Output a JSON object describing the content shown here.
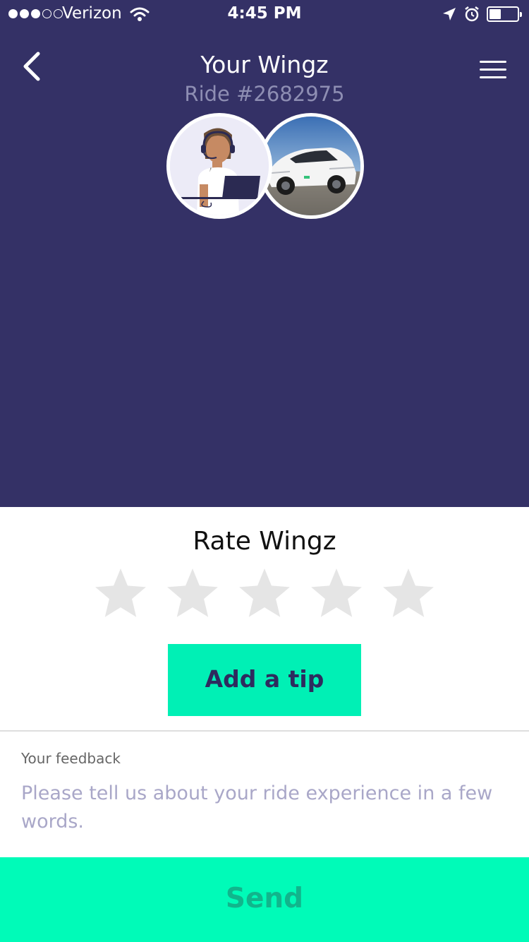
{
  "status_bar": {
    "carrier": "Verizon",
    "time": "4:45 PM",
    "signal_bars_filled": 3,
    "signal_bars_total": 5,
    "battery_level": 0.35
  },
  "header": {
    "title": "Your Wingz",
    "subtitle": "Ride #2682975",
    "back_icon": "chevron-left-icon",
    "menu_icon": "hamburger-menu-icon"
  },
  "rating": {
    "title": "Rate Wingz",
    "max_stars": 5,
    "selected_stars": 0
  },
  "tip_button": {
    "label": "Add a tip"
  },
  "feedback": {
    "label": "Your feedback",
    "placeholder": "Please tell us about your ride experience in a few words.",
    "value": ""
  },
  "send_button": {
    "label": "Send"
  },
  "colors": {
    "header_bg": "#343166",
    "accent": "#00f0b5",
    "send_bg": "#00fbb8",
    "send_text": "#11b58c",
    "star_empty": "#e5e5e5"
  }
}
